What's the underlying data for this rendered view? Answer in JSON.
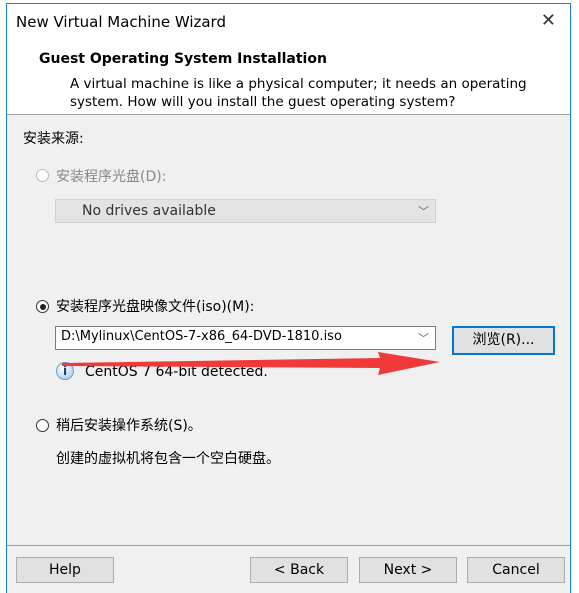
{
  "window": {
    "title": "New Virtual Machine Wizard",
    "close_icon": "close-icon"
  },
  "header": {
    "title": "Guest Operating System Installation",
    "description_line1": "A virtual machine is like a physical computer; it needs an operating",
    "description_line2": "system. How will you install the guest operating system?"
  },
  "body": {
    "source_label": "安装来源:",
    "options": [
      {
        "label": "安装程序光盘(D):",
        "selected": false,
        "enabled": false,
        "combo_value": "No drives available"
      },
      {
        "label": "安装程序光盘映像文件(iso)(M):",
        "selected": true,
        "enabled": true,
        "combo_value": "D:\\Mylinux\\CentOS-7-x86_64-DVD-1810.iso",
        "browse_label": "浏览(R)...",
        "detected": "CentOS 7 64-bit detected."
      },
      {
        "label": "稍后安装操作系统(S)。",
        "selected": false,
        "enabled": true,
        "note": "创建的虚拟机将包含一个空白硬盘。"
      }
    ]
  },
  "footer": {
    "help": "Help",
    "back": "< Back",
    "next": "Next >",
    "cancel": "Cancel"
  },
  "colors": {
    "accent": "#0078d7",
    "annotation_arrow": "#f03a3a"
  }
}
